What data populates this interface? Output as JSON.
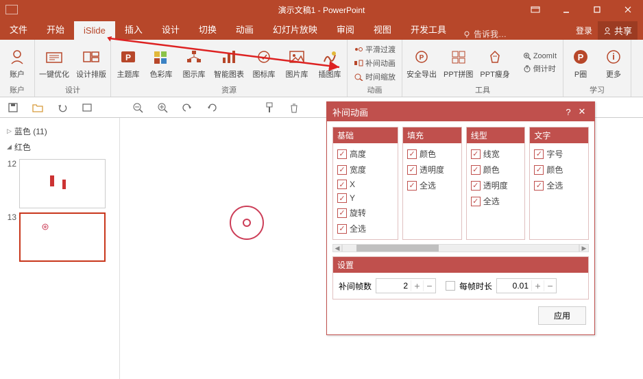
{
  "title": "演示文稿1 - PowerPoint",
  "login": "登录",
  "share": "共享",
  "tellme": "告诉我…",
  "menu": {
    "file": "文件",
    "home": "开始",
    "islide": "iSlide",
    "insert": "插入",
    "design": "设计",
    "transitions": "切换",
    "animations": "动画",
    "slideshow": "幻灯片放映",
    "review": "审阅",
    "view": "视图",
    "dev": "开发工具"
  },
  "ribbon": {
    "group_account": "账户",
    "group_design": "设计",
    "group_resource": "资源",
    "group_anim": "动画",
    "group_tools": "工具",
    "group_learn": "学习",
    "account": "账户",
    "one_click": "一键优化",
    "design_layout": "设计排版",
    "theme": "主题库",
    "color": "色彩库",
    "diagram": "图示库",
    "smartchart": "智能图表",
    "icon": "图标库",
    "pic": "图片库",
    "illust": "插图库",
    "tween_smooth": "平滑过渡",
    "tween_anim": "补间动画",
    "tween_zoom": "时间缩放",
    "export": "安全导出",
    "ppt_puzzle": "PPT拼图",
    "ppt_slim": "PPT瘦身",
    "zoomit": "ZoomIt",
    "timer": "倒计时",
    "pquan": "P圈",
    "more": "更多"
  },
  "nav": {
    "blue": "蓝色 (11)",
    "red": "红色",
    "slide12": "12",
    "slide13": "13"
  },
  "dialog": {
    "title": "补间动画",
    "groups": {
      "base": {
        "label": "基础",
        "items": [
          "高度",
          "宽度",
          "X",
          "Y",
          "旋转",
          "全选"
        ]
      },
      "fill": {
        "label": "填充",
        "items": [
          "颜色",
          "透明度",
          "全选"
        ]
      },
      "line": {
        "label": "线型",
        "items": [
          "线宽",
          "颜色",
          "透明度",
          "全选"
        ]
      },
      "text": {
        "label": "文字",
        "items": [
          "字号",
          "颜色",
          "全选"
        ]
      }
    },
    "settings_label": "设置",
    "frames_label": "补间帧数",
    "frames_value": "2",
    "duration_label": "每帧时长",
    "duration_value": "0.01",
    "apply": "应用"
  }
}
